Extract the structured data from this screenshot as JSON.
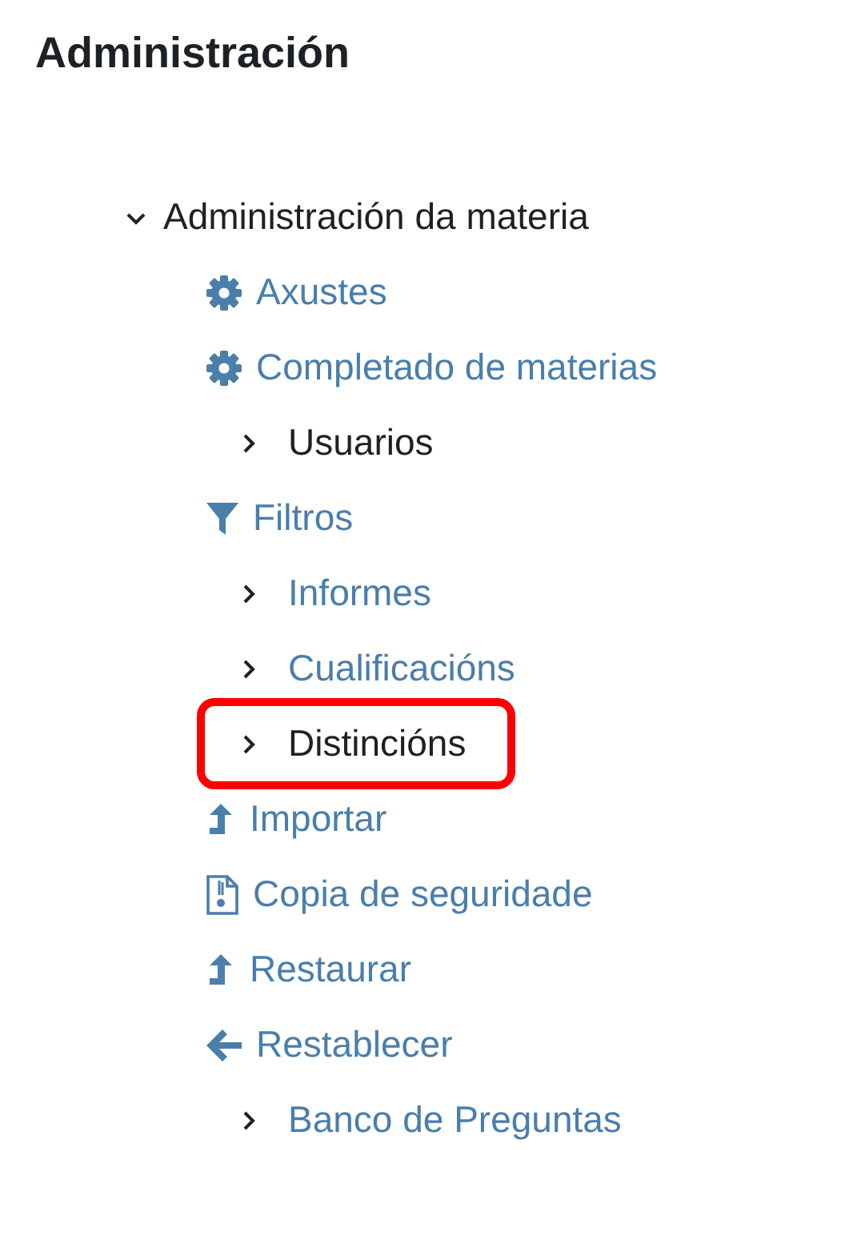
{
  "heading": "Administración",
  "tree": {
    "label": "Administración da materia",
    "expanded": true,
    "children": [
      {
        "kind": "gear",
        "label": "Axustes",
        "link": true,
        "highlighted": false
      },
      {
        "kind": "gear",
        "label": "Completado de materias",
        "link": true,
        "highlighted": false
      },
      {
        "kind": "branch",
        "label": "Usuarios",
        "link": false,
        "highlighted": false
      },
      {
        "kind": "filter",
        "label": "Filtros",
        "link": true,
        "highlighted": false
      },
      {
        "kind": "branch",
        "label": "Informes",
        "link": true,
        "highlighted": false
      },
      {
        "kind": "branch",
        "label": "Cualificacións",
        "link": true,
        "highlighted": false
      },
      {
        "kind": "branch",
        "label": "Distincións",
        "link": false,
        "highlighted": true
      },
      {
        "kind": "upload",
        "label": "Importar",
        "link": true,
        "highlighted": false
      },
      {
        "kind": "file",
        "label": "Copia de seguridade",
        "link": true,
        "highlighted": false
      },
      {
        "kind": "upload",
        "label": "Restaurar",
        "link": true,
        "highlighted": false
      },
      {
        "kind": "back",
        "label": "Restablecer",
        "link": true,
        "highlighted": false
      },
      {
        "kind": "branch",
        "label": "Banco de Preguntas",
        "link": true,
        "highlighted": false
      }
    ]
  }
}
